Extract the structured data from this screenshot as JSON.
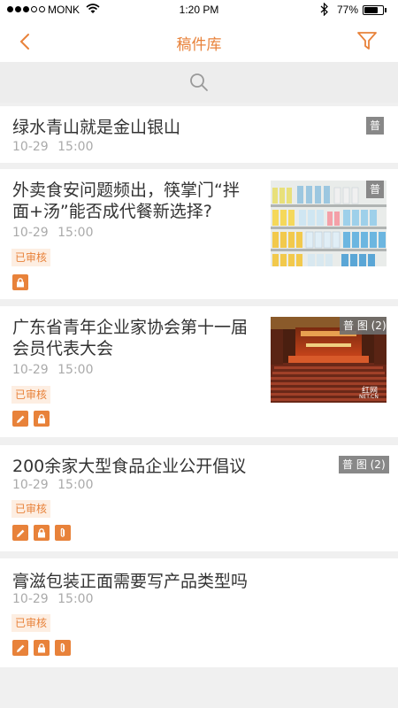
{
  "status_bar": {
    "carrier": "MONK",
    "time": "1:20 PM",
    "battery": "77%",
    "battery_level": 0.77
  },
  "header": {
    "title": "稿件库",
    "back_icon": "chevron-left-icon",
    "filter_icon": "filter-icon"
  },
  "search": {
    "icon": "search-icon"
  },
  "articles": [
    {
      "title_lines": [
        "绿水青山就是金山银山"
      ],
      "date": "10-29",
      "time": "15:00",
      "badge": "普"
    },
    {
      "title_lines": [
        "外卖食安问题频出，筷掌门“拌",
        "面+汤”能否成代餐新选择?"
      ],
      "date": "10-29",
      "time": "15:00",
      "badge": "普",
      "status": "已审核"
    },
    {
      "title_lines": [
        "广东省青年企业家协会第十一届",
        "会员代表大会"
      ],
      "date": "10-29",
      "time": "15:00",
      "badge": "普 图 (2)",
      "status": "已审核",
      "image_watermark": "红网",
      "image_watermark_sub": "NET.CN"
    },
    {
      "title_lines": [
        "200余家大型食品企业公开倡议"
      ],
      "date": "10-29",
      "time": "15:00",
      "badge": "普 图 (2)",
      "status": "已审核"
    },
    {
      "title_lines": [
        "膏滋包装正面需要写产品类型吗"
      ],
      "date": "10-29",
      "time": "15:00",
      "status": "已审核"
    }
  ],
  "colors": {
    "accent": "#e8823a",
    "tag_bg": "#fdeee2",
    "badge_bg": "#888888"
  }
}
